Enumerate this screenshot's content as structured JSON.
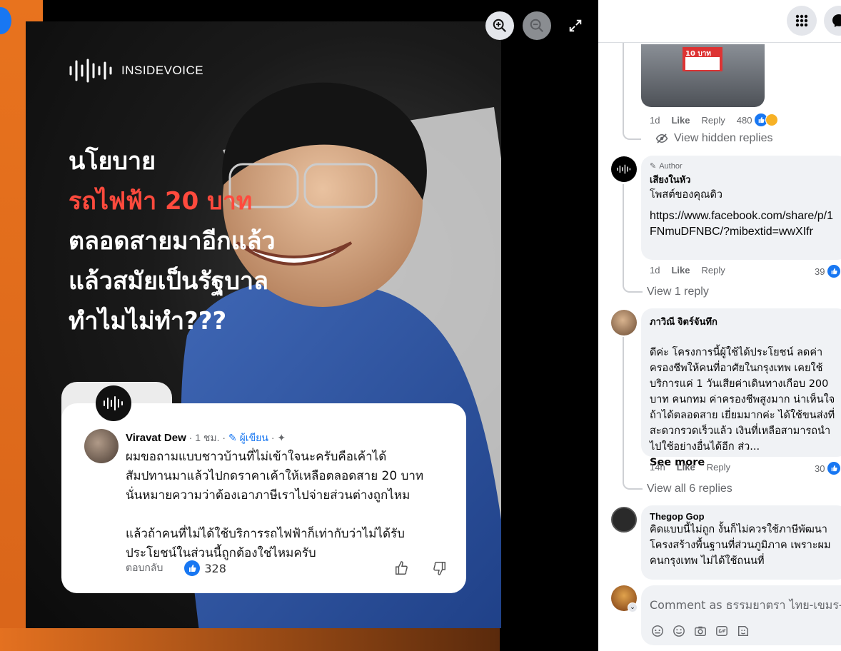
{
  "post": {
    "brand": "INSIDEVOICE",
    "headline": [
      "นโยบาย",
      "รถไฟฟ้า 20 บาท",
      "ตลอดสายมาอีกแล้ว",
      "แล้วสมัยเป็นรัฐบาล",
      "ทำไมไม่ทำ???"
    ],
    "quote": {
      "name": "Viravat Dew",
      "time": "· 1 ชม. ·",
      "author_label": "ผู้เขียน",
      "body": "ผมขอถามแบบชาวบ้านที่ไม่เข้าใจนะครับคือเค้าได้\nสัมปทานมาแล้วไปกดราคาเค้าให้เหลือตลอดสาย 20 บาท\nนั่นหมายความว่าต้องเอาภาษีเราไปจ่ายส่วนต่างถูกไหม\n\n แล้วถ้าคนที่ไม่ได้ใช้บริการรถไฟฟ้าก็เท่ากับว่าไม่ได้รับ\nประโยชน์ในส่วนนี้ถูกต้องใช่ไหมครับ",
      "reply": "ตอบกลับ",
      "likes": "328"
    }
  },
  "comments": {
    "c0": {
      "time": "1d",
      "like": "Like",
      "reply": "Reply",
      "count": "480",
      "sign_text": "10 บาท"
    },
    "hidden_replies": "View hidden replies",
    "c1": {
      "author_tag": "Author",
      "name": "เสียงในหัว",
      "text": "โพสต์ของคุณดิว",
      "link": "https://www.facebook.com/share/p/1FNmuDFNBC/?mibextid=wwXIfr",
      "time": "1d",
      "like": "Like",
      "reply": "Reply",
      "count": "39",
      "more": "View 1 reply"
    },
    "c2": {
      "name": "ภาวิณี จิตร์จันทึก",
      "text": "ดีค่ะ โครงการนี้ผู้ใช้ได้ประโยชน์ ลดค่าครองชีพให้คนที่อาศัยในกรุงเทพ เคยใช้บริการแค่ 1 วันเสียค่าเดินทางเกือบ 200 บาท คนกทม ค่าครองชีพสูงมาก น่าเห็นใจถ้าได้ตลอดสาย เยี่ยมมากค่ะ ได้ใช้ขนส่งที่สะดวกรวดเร็วแล้ว เงินที่เหลือสามารถนำไปใช้อย่างอื่นได้อีก ส่ว...",
      "see_more": "See more",
      "time": "14h",
      "like": "Like",
      "reply": "Reply",
      "count": "30",
      "more": "View all 6 replies"
    },
    "c3": {
      "name": "Thegop Gop",
      "text": "คิดแบบนี้ไม่ถูก งั้นก็ไม่ควรใช้ภาษีพัฒนาโครงสร้างพื้นฐานที่ส่วนภูมิภาค เพราะผมคนกรุงเทพ ไม่ได้ใช้ถนนที่"
    }
  },
  "composer": {
    "placeholder": "Comment as ธรรมยาตรา ไทย-เขมร-ลาว"
  },
  "icons": [
    "zoom-in-icon",
    "zoom-out-icon",
    "fullscreen-icon",
    "grid-menu-icon",
    "messenger-icon",
    "eye-slash-icon",
    "pencil-icon",
    "pin-icon",
    "thumbs-up-icon",
    "thumbs-down-icon",
    "avatar-icon",
    "sticker-icon",
    "emoji-icon",
    "camera-icon",
    "gif-icon"
  ],
  "colors": {
    "accent": "#1877f2",
    "headline_red": "#ff4a3d",
    "bubble": "#f0f2f5"
  }
}
